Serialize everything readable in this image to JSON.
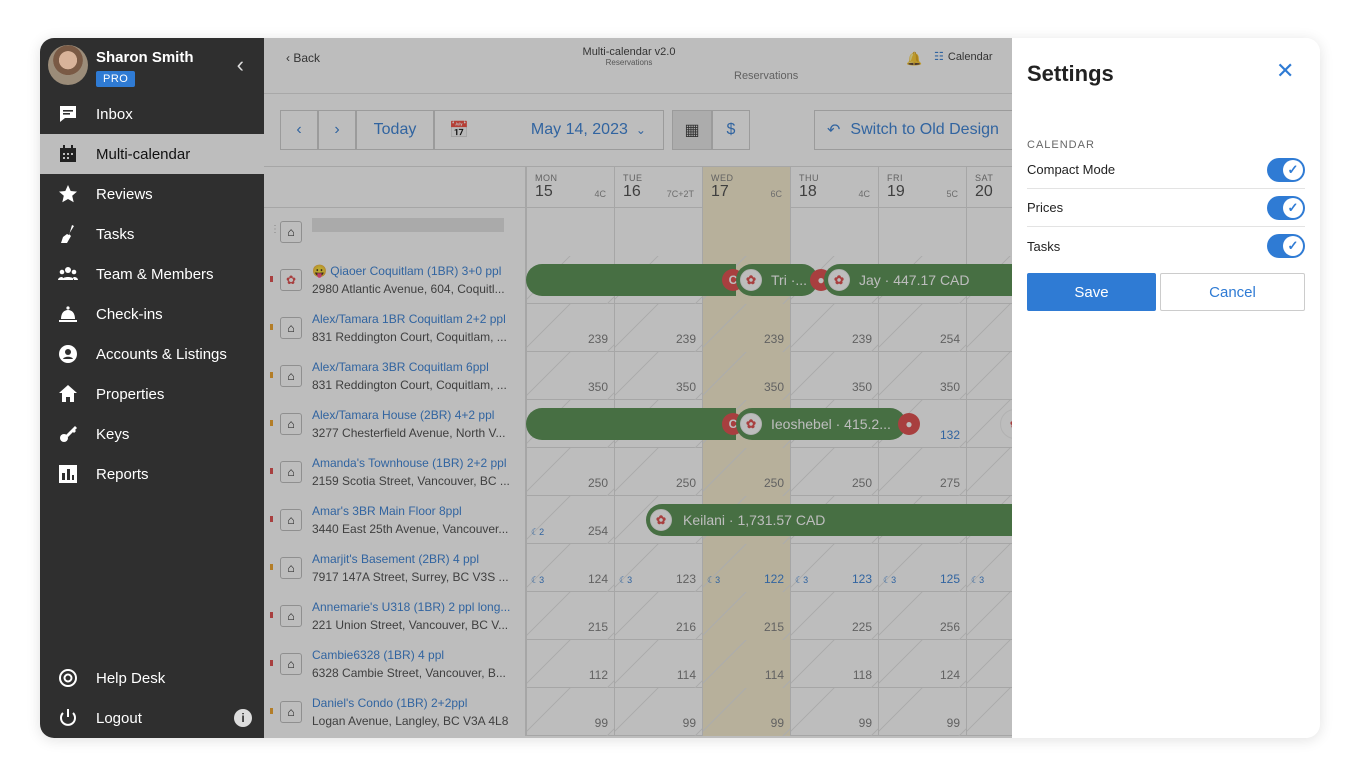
{
  "user": {
    "name": "Sharon Smith",
    "badge": "PRO"
  },
  "nav": [
    {
      "label": "Inbox",
      "icon": "inbox-icon"
    },
    {
      "label": "Multi-calendar",
      "icon": "calendar-icon",
      "active": true
    },
    {
      "label": "Reviews",
      "icon": "star-icon"
    },
    {
      "label": "Tasks",
      "icon": "broom-icon"
    },
    {
      "label": "Team & Members",
      "icon": "team-icon"
    },
    {
      "label": "Check-ins",
      "icon": "bell-icon"
    },
    {
      "label": "Accounts & Listings",
      "icon": "account-icon"
    },
    {
      "label": "Properties",
      "icon": "house-icon"
    },
    {
      "label": "Keys",
      "icon": "key-icon"
    },
    {
      "label": "Reports",
      "icon": "chart-icon"
    }
  ],
  "bottom_nav": [
    {
      "label": "Help Desk",
      "icon": "lifebuoy-icon"
    },
    {
      "label": "Logout",
      "icon": "power-icon"
    }
  ],
  "header": {
    "back": "Back",
    "title": "Multi-calendar v2.0",
    "subtitle": "Reservations",
    "subtitle_ghost": "Reservations",
    "calendar_btn": "Calendar"
  },
  "toolbar": {
    "today": "Today",
    "date": "May 14, 2023",
    "switch": "Switch to Old Design",
    "dollar": "$"
  },
  "days": [
    {
      "dow": "MON",
      "num": "15",
      "extra": "4C"
    },
    {
      "dow": "TUE",
      "num": "16",
      "extra": "7C+2T"
    },
    {
      "dow": "WED",
      "num": "17",
      "extra": "6C",
      "today": true
    },
    {
      "dow": "THU",
      "num": "18",
      "extra": "4C"
    },
    {
      "dow": "FRI",
      "num": "19",
      "extra": "5C"
    },
    {
      "dow": "SAT",
      "num": "20",
      "extra": ""
    }
  ],
  "listings": [
    {
      "name": "😛 Qiaoer Coquitlam (1BR) 3+0 ppl",
      "address": "2980 Atlantic Avenue, 604, Coquitl...",
      "prices": [
        "",
        "",
        "",
        "",
        "",
        ""
      ],
      "dot": "#e04444",
      "airbnb": true
    },
    {
      "name": "Alex/Tamara 1BR Coquitlam 2+2 ppl",
      "address": "831 Reddington Court, Coquitlam, ...",
      "prices": [
        "239",
        "239",
        "239",
        "239",
        "254",
        ""
      ],
      "dot": "#f0a020"
    },
    {
      "name": "Alex/Tamara 3BR Coquitlam 6ppl",
      "address": "831 Reddington Court, Coquitlam, ...",
      "prices": [
        "350",
        "350",
        "350",
        "350",
        "350",
        ""
      ],
      "dot": "#f0a020"
    },
    {
      "name": "Alex/Tamara House (2BR) 4+2 ppl",
      "address": "3277 Chesterfield Avenue, North V...",
      "prices": [
        "",
        "",
        "",
        "",
        "132",
        ""
      ],
      "dot": "#f0a020"
    },
    {
      "name": "Amanda's Townhouse (1BR) 2+2 ppl",
      "address": "2159 Scotia Street, Vancouver, BC ...",
      "prices": [
        "250",
        "250",
        "250",
        "250",
        "275",
        ""
      ],
      "dot": "#e04444"
    },
    {
      "name": "Amar's 3BR Main Floor 8ppl",
      "address": "3440 East 25th Avenue, Vancouver...",
      "prices": [
        "254",
        "",
        "",
        "",
        "",
        ""
      ],
      "dot": "#e04444"
    },
    {
      "name": "Amarjit's Basement (2BR) 4 ppl",
      "address": "7917 147A Street, Surrey, BC V3S ...",
      "prices": [
        "124",
        "123",
        "122",
        "123",
        "125",
        ""
      ],
      "dot": "#f0a020"
    },
    {
      "name": "Annemarie's U318 (1BR) 2 ppl long...",
      "address": "221 Union Street, Vancouver, BC V...",
      "prices": [
        "215",
        "216",
        "215",
        "225",
        "256",
        ""
      ],
      "dot": "#e04444"
    },
    {
      "name": "Cambie6328 (1BR) 4 ppl",
      "address": "6328 Cambie Street, Vancouver, B...",
      "prices": [
        "112",
        "114",
        "114",
        "118",
        "124",
        ""
      ],
      "dot": "#e04444"
    },
    {
      "name": "Daniel's Condo (1BR) 2+2ppl",
      "address": "Logan Avenue, Langley, BC V3A 4L8",
      "prices": [
        "99",
        "99",
        "99",
        "99",
        "99",
        ""
      ],
      "dot": "#f0a020"
    }
  ],
  "reservations": {
    "r1": "Tri ·...",
    "r2": "Jay · 447.17 CAD",
    "r3": "Ieoshebel · 415.2...",
    "r4": "Keilani · 1,731.57 CAD",
    "moon2": "2",
    "moon3": "3",
    "c_badge": "C"
  },
  "settings": {
    "title": "Settings",
    "section": "CALENDAR",
    "toggles": [
      {
        "label": "Compact Mode",
        "on": true
      },
      {
        "label": "Prices",
        "on": true
      },
      {
        "label": "Tasks",
        "on": true
      }
    ],
    "save": "Save",
    "cancel": "Cancel"
  }
}
